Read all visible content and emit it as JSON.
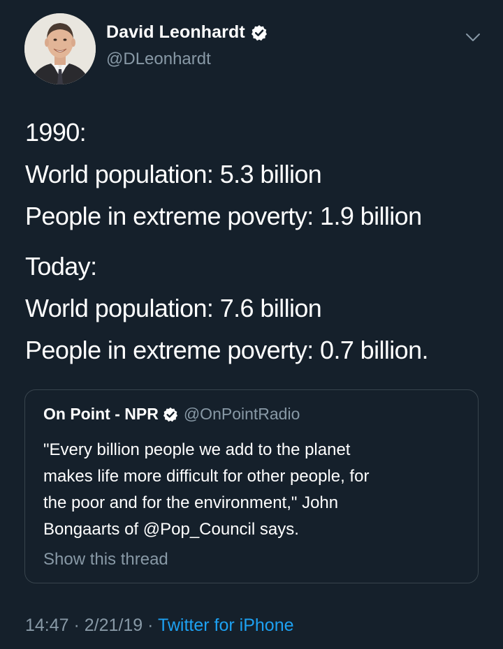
{
  "author": {
    "name": "David Leonhardt",
    "handle": "@DLeonhardt",
    "verified": true
  },
  "icons": {
    "verified": "verified-badge-icon",
    "menu": "chevron-down-icon"
  },
  "body": {
    "block1": {
      "heading": "1990:",
      "line1": "World population: 5.3 billion",
      "line2": "People in extreme poverty: 1.9 billion"
    },
    "block2": {
      "heading": "Today:",
      "line1": "World population:  7.6 billion",
      "line2": "People in extreme poverty: 0.7 billion."
    }
  },
  "quote": {
    "name": "On Point - NPR",
    "handle": "@OnPointRadio",
    "verified": true,
    "lines": [
      "\"Every billion people we add to the planet",
      "makes life more difficult for other people, for",
      "the poor and for the environment,\" John",
      "Bongaarts of @Pop_Council says."
    ],
    "show_thread": "Show this thread"
  },
  "footer": {
    "time": "14:47",
    "sep1": " · ",
    "date": "2/21/19",
    "sep2": " · ",
    "source": "Twitter for iPhone"
  },
  "colors": {
    "background": "#15202b",
    "text": "#ffffff",
    "secondary": "#8899a6",
    "accent": "#1da1f2",
    "border": "#38444d"
  }
}
